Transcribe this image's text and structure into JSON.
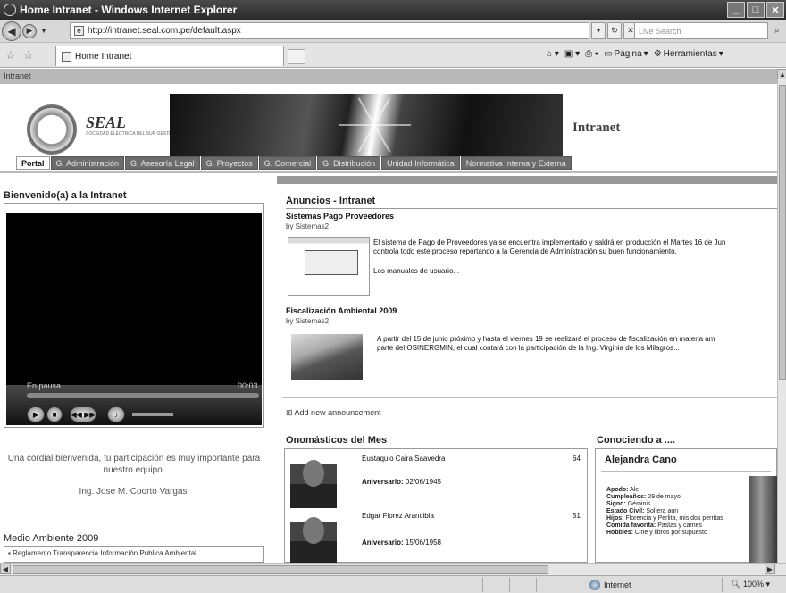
{
  "browser": {
    "window_title": "Home Intranet - Windows Internet Explorer",
    "url": "http://intranet.seal.com.pe/default.aspx",
    "search_placeholder": "Live Search",
    "tab_title": "Home Intranet",
    "cmd_pagina": "Página",
    "cmd_herramientas": "Herramientas",
    "status_zone": "Internet",
    "zoom": "100%"
  },
  "site": {
    "band_label": "Intranet",
    "logo_text": "SEAL",
    "logo_sub": "SOCIEDAD ELÉCTRICA DEL SUR OESTE S.A.",
    "header_title": "Intranet",
    "nav_tabs": [
      "Portal",
      "G. Administración",
      "G. Asesoría Legal",
      "G. Proyectos",
      "G. Comercial",
      "G. Distribución",
      "Unidad Informática",
      "Normativa Interna y Externa"
    ]
  },
  "left": {
    "welcome_title": "Bienvenido(a) a la Intranet",
    "player_status": "En pausa",
    "player_time": "00:03",
    "welcome_msg": "Una cordial bienvenida, tu participación es muy importante para nuestro equipo.",
    "signature": "Ing. Jose M. Coorto Vargas'",
    "medio_title": "Medio Ambiente 2009",
    "medio_item": "Reglamento Transparencia Información Publica Ambiental"
  },
  "anuncios": {
    "title": "Anuncios - Intranet",
    "items": [
      {
        "title": "Sistemas Pago Proveedores",
        "by": "by Sistemas2",
        "line1": "El sistema de Pago de Proveedores ya se encuentra implementado y saldrá en producción el Martes 16 de Jun",
        "line2": "controla todo este proceso  reportando a la Gerencia de Administración su buen funcionamiento.",
        "line3": "Los manuales de usuario..."
      },
      {
        "title": "Fiscalización Ambiental 2009",
        "by": "by Sistemas2",
        "line1": "A partir del 15 de junio próximo y hasta el viernes 19 se realizará el proceso de fiscalización en materia am",
        "line2": "parte del OSINERGMIN, el cual contará con la participación de la Ing. Virginia de los Milagros..."
      }
    ],
    "add_new": "Add new announcement"
  },
  "onomasticos": {
    "title": "Onomásticos del Mes",
    "ann_label": "Aniversario:",
    "people": [
      {
        "name": "Eustaquio Caira Saavedra",
        "age": "64",
        "date": "02/06/1945"
      },
      {
        "name": "Edgar Florez Arancibia",
        "age": "51",
        "date": "15/06/1958"
      }
    ]
  },
  "conociendo": {
    "title": "Conociendo a ....",
    "name": "Alejandra Cano",
    "facts": [
      {
        "k": "Apodo:",
        "v": "Ale"
      },
      {
        "k": "Cumpleaños:",
        "v": "29 de mayo"
      },
      {
        "k": "Signo:",
        "v": "Géminis"
      },
      {
        "k": "Estado Civil:",
        "v": "Soltera aun"
      },
      {
        "k": "Hijos:",
        "v": "Florencia y Perlita, mis dos perritas"
      },
      {
        "k": "Comida favorita:",
        "v": "Pastas y carnes"
      },
      {
        "k": "Hobbies:",
        "v": "Cine y libros por supuesto"
      }
    ]
  }
}
